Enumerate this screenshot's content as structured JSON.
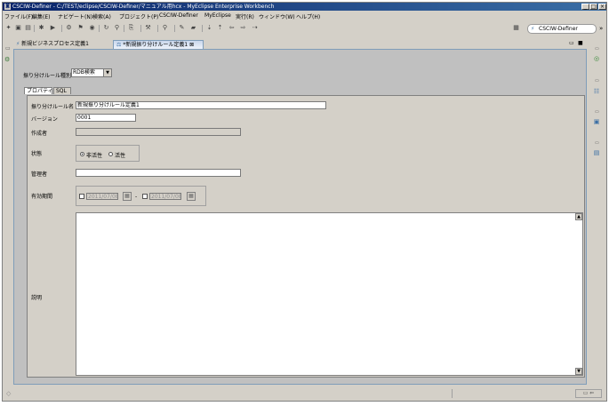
{
  "window": {
    "title": "CSCIW-Definer - C:/TEST/eclipse/CSCIW-Definer/マニュアル用hcx - MyEclipse Enterprise Workbench",
    "minimize": "_",
    "maximize": "□",
    "close": "×"
  },
  "menu": [
    "ファイル(F)",
    "編集(E)",
    "ナビゲート(N)",
    "検索(A)",
    "プロジェクト(P)",
    "CSCIW-Definer",
    "MyEclipse",
    "実行(R)",
    "ウィンドウ(W)",
    "ヘルプ(H)"
  ],
  "perspective": {
    "label": "CSCIW-Definer",
    "more": "»"
  },
  "tabs": [
    {
      "label": "新規ビジネスプロセス定義1"
    },
    {
      "label": "*新規振り分けルール定義1",
      "close": "⊠"
    }
  ],
  "editor_controls": {
    "minimize": "▭",
    "maximize": "■"
  },
  "form": {
    "rule_type_label": "振り分けルール種別",
    "rule_type_value": "RDB検索",
    "subtabs": [
      "プロパティ",
      "SQL"
    ],
    "rule_name_label": "振り分けルール名",
    "rule_name_value": "新規振り分けルール定義1",
    "version_label": "バージョン",
    "version_value": "0001",
    "author_label": "作成者",
    "author_value": "",
    "status_label": "状態",
    "status_inactive": "非活性",
    "status_active": "活性",
    "admin_label": "管理者",
    "admin_value": "",
    "validity_label": "有効期間",
    "date_from": "2011/07/08",
    "date_sep": "-",
    "date_to": "2011/07/08",
    "description_label": "説明",
    "description_value": ""
  }
}
